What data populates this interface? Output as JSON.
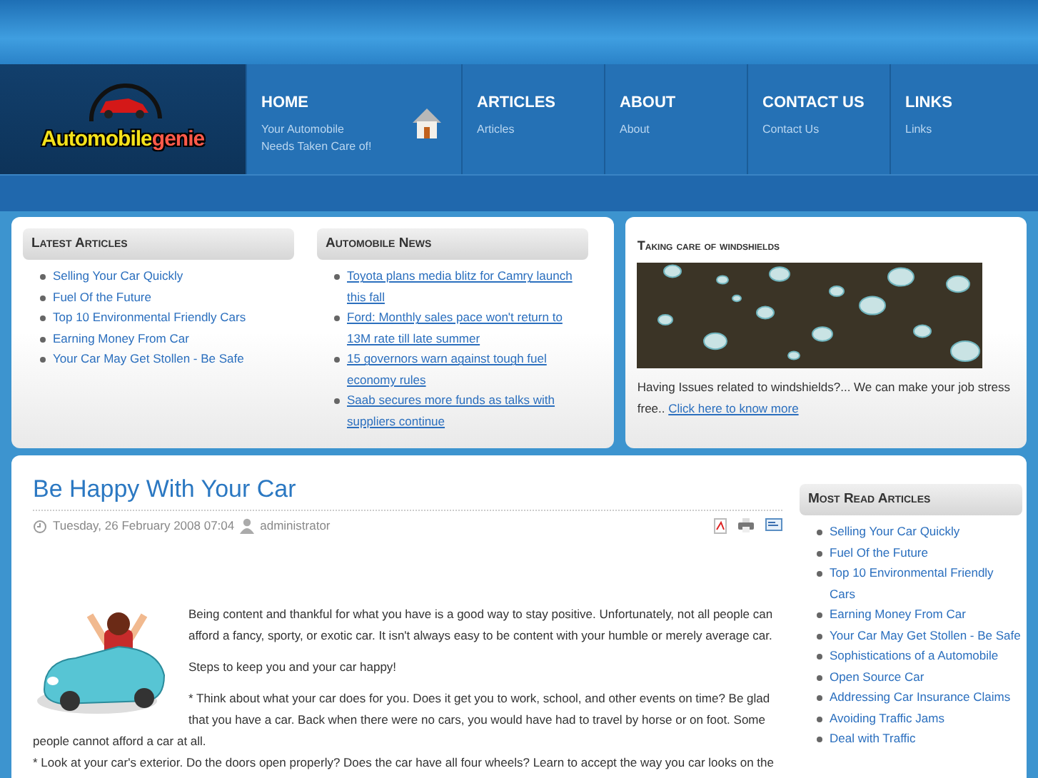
{
  "logo": {
    "part_1": "Automobile",
    "part_2": "genie"
  },
  "nav": [
    {
      "title": "HOME",
      "subtitle": "Your Automobile Needs Taken Care of!",
      "kind": "home"
    },
    {
      "title": "ARTICLES",
      "subtitle": "Articles",
      "kind": "plain"
    },
    {
      "title": "ABOUT",
      "subtitle": "About",
      "kind": "plain"
    },
    {
      "title": "CONTACT US",
      "subtitle": "Contact Us",
      "kind": "plain"
    },
    {
      "title": "LINKS",
      "subtitle": "Links",
      "kind": "plain"
    }
  ],
  "latest_articles": {
    "heading": "Latest Articles",
    "items": [
      "Selling Your Car Quickly",
      "Fuel Of the Future",
      "Top 10 Environmental Friendly Cars",
      "Earning Money From Car",
      "Your Car May Get Stollen - Be Safe"
    ]
  },
  "automobile_news": {
    "heading": "Automobile News",
    "items": [
      "Toyota plans media blitz for Camry launch this fall",
      "Ford: Monthly sales pace won't return to 13M rate till late summer",
      "15 governors warn against tough fuel economy rules",
      "Saab secures more funds as talks with suppliers continue"
    ]
  },
  "feature": {
    "heading": "Taking care of windshields",
    "image": {
      "kind": "picture"
    },
    "text": "Having Issues related to windshields?... We can make your job stress free..",
    "link": "Click here to know more"
  },
  "article": {
    "title": "Be Happy With Your Car",
    "date": "Tuesday, 26 February 2008 07:04",
    "author": "administrator",
    "image": {
      "kind": "picture"
    },
    "paragraphs": [
      "Being content and thankful for what you have is a good way to stay positive. Unfortunately, not all people can afford a fancy, sporty, or exotic car. It isn't always easy to be content with your humble or merely average car.",
      "Steps to keep you and your car happy!",
      "* Think about what your car does for you. Does it get you to work, school, and other events on time? Be glad that you have a car. Back when there were no cars, you would have had to travel by horse or on foot. Some people cannot afford a car at all.",
      "* Look at your car's exterior. Do the doors open properly? Does the car have all four wheels? Learn to accept the way you car looks on the"
    ]
  },
  "most_read": {
    "heading": "Most Read Articles",
    "items": [
      "Selling Your Car Quickly",
      "Fuel Of the Future",
      "Top 10 Environmental Friendly Cars",
      "Earning Money From Car",
      "Your Car May Get Stollen - Be Safe",
      "Sophistications of a Automobile",
      "Open Source Car",
      "Addressing Car Insurance Claims",
      "Avoiding Traffic Jams",
      "Deal with Traffic"
    ]
  }
}
